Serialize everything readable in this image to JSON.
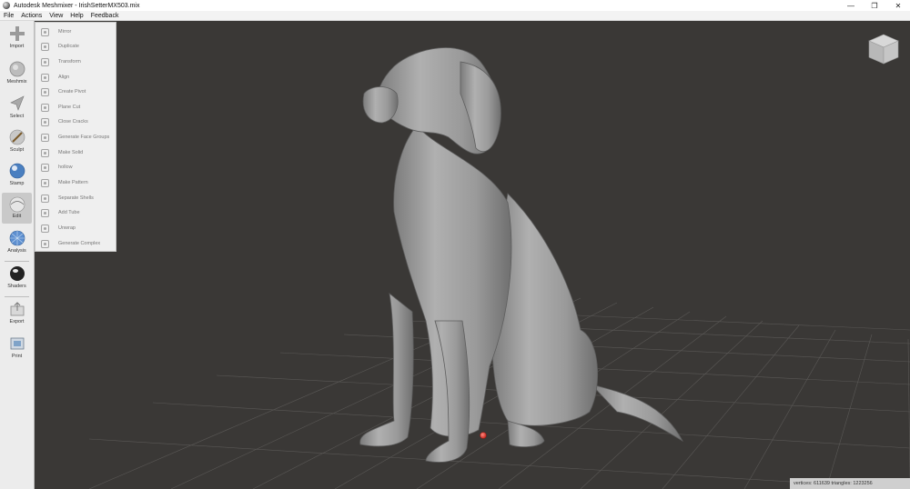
{
  "window": {
    "title": "Autodesk Meshmixer - IrishSetterMX503.mix",
    "controls": {
      "minimize": "—",
      "restore": "❐",
      "close": "✕"
    }
  },
  "menu": [
    "File",
    "Actions",
    "View",
    "Help",
    "Feedback"
  ],
  "toolbar": [
    {
      "id": "import",
      "label": "Import",
      "icon": "plus-icon"
    },
    {
      "id": "meshmix",
      "label": "Meshmix",
      "icon": "meshmix-icon"
    },
    {
      "id": "select",
      "label": "Select",
      "icon": "select-arrow-icon"
    },
    {
      "id": "sculpt",
      "label": "Sculpt",
      "icon": "brush-icon"
    },
    {
      "id": "stamp",
      "label": "Stamp",
      "icon": "stamp-icon"
    },
    {
      "id": "edit",
      "label": "Edit",
      "icon": "edit-icon",
      "active": true
    },
    {
      "id": "analysis",
      "label": "Analysis",
      "icon": "analysis-icon"
    },
    {
      "id": "shaders",
      "label": "Shaders",
      "icon": "shader-sphere-icon"
    },
    {
      "id": "export",
      "label": "Export",
      "icon": "export-icon"
    },
    {
      "id": "print",
      "label": "Print",
      "icon": "print-icon"
    }
  ],
  "edit_menu": [
    "Mirror",
    "Duplicate",
    "Transform",
    "Align",
    "Create Pivot",
    "Plane Cut",
    "Close Cracks",
    "Generate Face Groups",
    "Make Solid",
    "hollow",
    "Make Pattern",
    "Separate Shells",
    "Add Tube",
    "Unwrap",
    "Generate Complex"
  ],
  "status_bar": {
    "text": "vertices: 611639 triangles: 1223256"
  },
  "colors": {
    "viewport_bg": "#3a3836",
    "grid": "#5a5856",
    "model": "#9a9a9a",
    "pivot": "#e0332a"
  }
}
